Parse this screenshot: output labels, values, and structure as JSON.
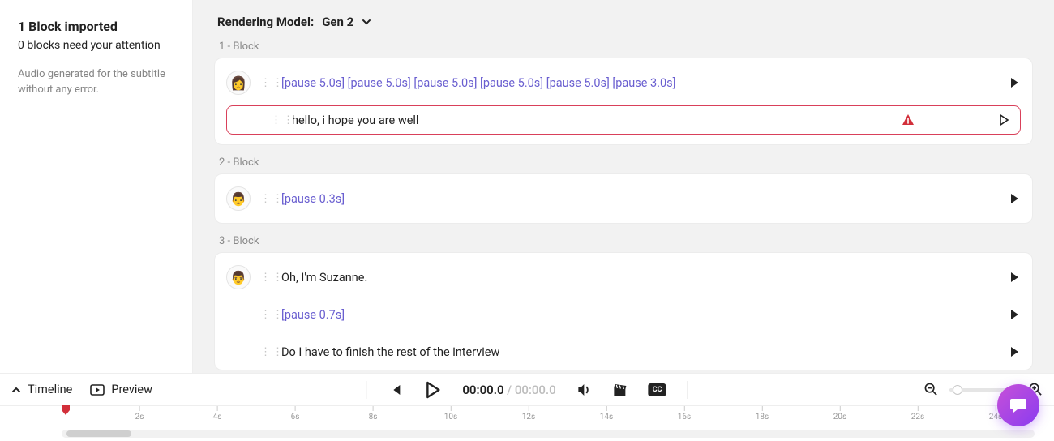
{
  "sidebar": {
    "title": "1 Block imported",
    "subtitle": "0 blocks need your attention",
    "note": "Audio generated for the subtitle without any error."
  },
  "header": {
    "model_prefix": "Rendering Model:",
    "model_value": "Gen 2"
  },
  "blocks": [
    {
      "label": "1 -   Block",
      "lines": [
        {
          "avatar": "👩",
          "text": "[pause 5.0s] [pause 5.0s] [pause 5.0s] [pause 5.0s] [pause 5.0s] [pause 3.0s]",
          "pause": true,
          "error": false
        },
        {
          "avatar": null,
          "text": "hello, i hope you are well",
          "pause": false,
          "error": true
        }
      ]
    },
    {
      "label": "2 -   Block",
      "lines": [
        {
          "avatar": "👨",
          "text": "[pause 0.3s]",
          "pause": true,
          "error": false
        }
      ]
    },
    {
      "label": "3 -   Block",
      "lines": [
        {
          "avatar": "👨",
          "text": "Oh, I'm Suzanne.",
          "pause": false,
          "error": false
        },
        {
          "avatar": null,
          "text": "[pause 0.7s]",
          "pause": true,
          "error": false
        },
        {
          "avatar": null,
          "text": "Do I have to finish the rest of the interview",
          "pause": false,
          "error": false
        }
      ]
    }
  ],
  "playbar": {
    "timeline_label": "Timeline",
    "preview_label": "Preview",
    "time_current": "00:00.0",
    "time_total": "00:00.0",
    "cc_label": "CC"
  },
  "ruler": {
    "ticks": [
      "2s",
      "4s",
      "6s",
      "8s",
      "10s",
      "12s",
      "14s",
      "16s",
      "18s",
      "20s",
      "22s",
      "24s"
    ]
  }
}
